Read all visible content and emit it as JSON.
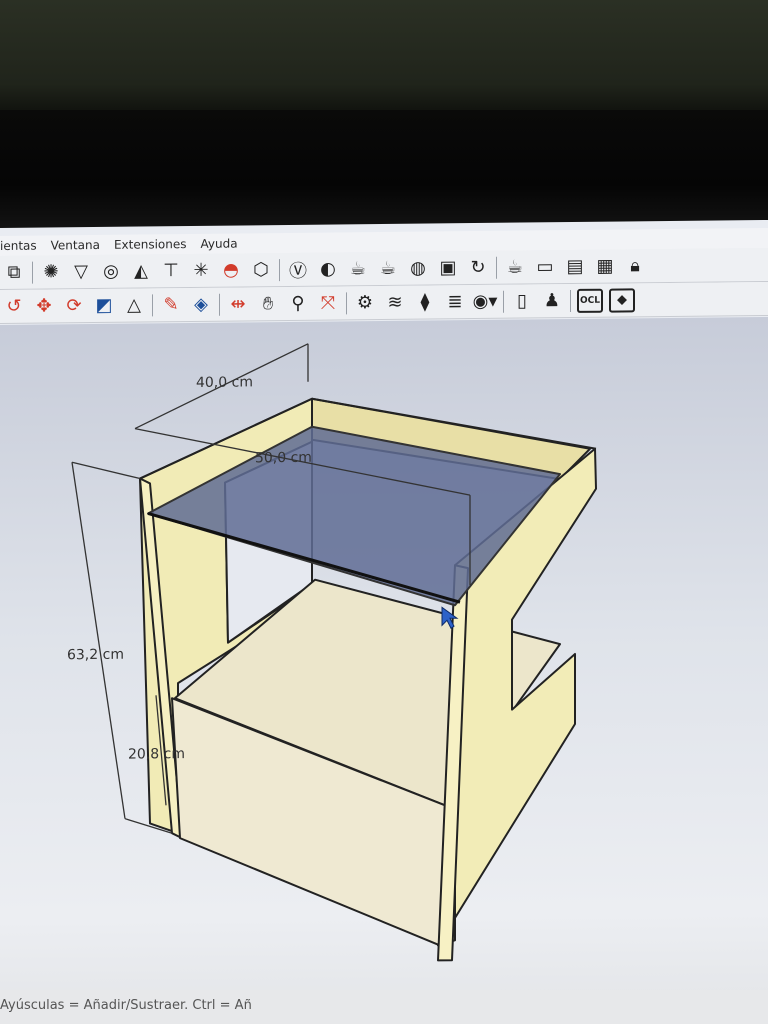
{
  "menu": {
    "items": [
      "ientas",
      "Ventana",
      "Extensiones",
      "Ayuda"
    ]
  },
  "toolbar_row1_icons": [
    "layers-icon",
    "sun-shadow-icon",
    "funnel-icon",
    "target-icon",
    "cone-icon",
    "pin-icon",
    "starburst-icon",
    "dome-icon",
    "cube-icon",
    "vray-icon",
    "palette-icon",
    "teapot-icon",
    "teapot-render-icon",
    "sphere-light-icon",
    "frame-icon",
    "refresh-icon",
    "cup-icon",
    "monitor-icon",
    "window-icon",
    "camera-teapot-icon",
    "lock-icon"
  ],
  "toolbar_row2_icons": [
    "rotate-icon",
    "move-icon",
    "cycle-icon",
    "scale-icon",
    "triangle-icon",
    "paint-icon",
    "bucket-icon",
    "mirror-icon",
    "hand-icon",
    "zoom-icon",
    "zoom-extents-icon",
    "gear-layers-icon",
    "stack-icon",
    "stack-arrow-icon",
    "stack-gear-icon",
    "user-menu-icon",
    "document-icon",
    "person-icon",
    "ocl-icon",
    "paint-tag-icon"
  ],
  "toolbar_ocl_label": "OCL",
  "dimensions": {
    "width": "40,0 cm",
    "depth": "50,0 cm",
    "height": "63,2 cm",
    "drawer": "20,8 cm"
  },
  "status_text": "Ayúsculas = Añadir/Sustraer. Ctrl = Añ",
  "colors": {
    "panel_face": "#f2ecb7",
    "panel_shadow": "#e3dba0",
    "drawer_face": "#efe9d0",
    "glass": "#5f6c94",
    "edge": "#222222"
  }
}
